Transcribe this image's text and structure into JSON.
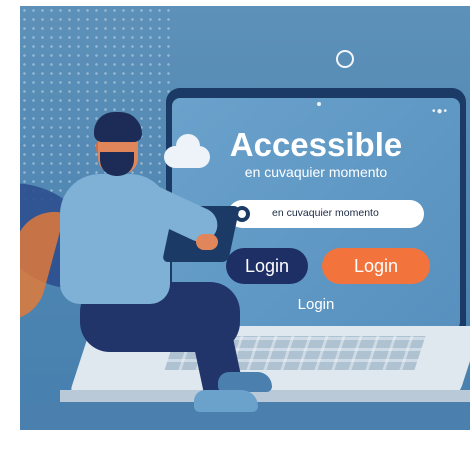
{
  "screen": {
    "headline": "Accessible",
    "subhead": "en cuvaquier momento",
    "search": {
      "text": "en cuvaquier momento"
    },
    "buttons": {
      "primary": "Login",
      "secondary": "Login"
    },
    "link": "Login"
  },
  "colors": {
    "background": "#5d91b9",
    "screen_frame": "#1c3a66",
    "button_dark": "#1e2f66",
    "button_orange": "#f2743c"
  }
}
